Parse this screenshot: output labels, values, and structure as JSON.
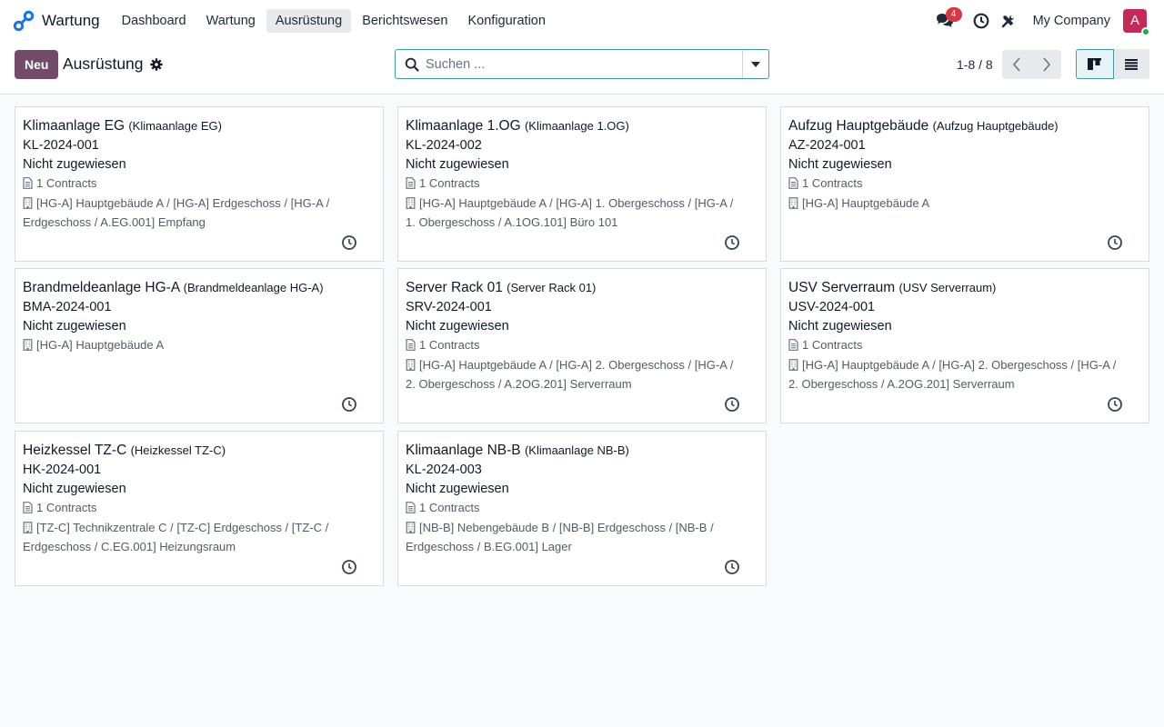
{
  "nav": {
    "app_name": "Wartung",
    "menu": [
      {
        "label": "Dashboard",
        "active": false
      },
      {
        "label": "Wartung",
        "active": false
      },
      {
        "label": "Ausrüstung",
        "active": true
      },
      {
        "label": "Berichtswesen",
        "active": false
      },
      {
        "label": "Konfiguration",
        "active": false
      }
    ],
    "messages_count": "4",
    "company": "My Company",
    "avatar_letter": "A"
  },
  "control": {
    "new_label": "Neu",
    "title": "Ausrüstung",
    "search_placeholder": "Suchen ...",
    "pager": "1-8 / 8"
  },
  "colors": {
    "brand": "#714b67",
    "accent": "#3f9d9d",
    "avatar": "#c42a55",
    "badge": "#dc3545"
  },
  "equipment": [
    {
      "name": "Klimaanlage EG",
      "display": "(Klimaanlage EG)",
      "code": "KL-2024-001",
      "assignee": "Nicht zugewiesen",
      "contracts": "1 Contracts",
      "location": "[HG-A] Hauptgebäude A / [HG-A] Erdgeschoss / [HG-A / Erdgeschoss / A.EG.001] Empfang",
      "loc1": "[HG-A] Hauptgebäude A / [HG-A] Erdgeschoss / [HG-A /",
      "loc2": "Erdgeschoss / A.EG.001] Empfang"
    },
    {
      "name": "Klimaanlage 1.OG",
      "display": "(Klimaanlage 1.OG)",
      "code": "KL-2024-002",
      "assignee": "Nicht zugewiesen",
      "contracts": "1 Contracts",
      "loc1": "[HG-A] Hauptgebäude A / [HG-A] 1. Obergeschoss / [HG-A /",
      "loc2": "1. Obergeschoss / A.1OG.101] Büro 101"
    },
    {
      "name": "Aufzug Hauptgebäude",
      "display": "(Aufzug Hauptgebäude)",
      "code": "AZ-2024-001",
      "assignee": "Nicht zugewiesen",
      "contracts": "1 Contracts",
      "loc1": "[HG-A] Hauptgebäude A",
      "loc2": ""
    },
    {
      "name": "Brandmeldeanlage HG-A",
      "display": "(Brandmeldeanlage HG-A)",
      "code": "BMA-2024-001",
      "assignee": "Nicht zugewiesen",
      "contracts": "",
      "loc1": "[HG-A] Hauptgebäude A",
      "loc2": ""
    },
    {
      "name": "Server Rack 01",
      "display": "(Server Rack 01)",
      "code": "SRV-2024-001",
      "assignee": "Nicht zugewiesen",
      "contracts": "1 Contracts",
      "loc1": "[HG-A] Hauptgebäude A / [HG-A] 2. Obergeschoss / [HG-A /",
      "loc2": "2. Obergeschoss / A.2OG.201] Serverraum"
    },
    {
      "name": "USV Serverraum",
      "display": "(USV Serverraum)",
      "code": "USV-2024-001",
      "assignee": "Nicht zugewiesen",
      "contracts": "1 Contracts",
      "loc1": "[HG-A] Hauptgebäude A / [HG-A] 2. Obergeschoss / [HG-A /",
      "loc2": "2. Obergeschoss / A.2OG.201] Serverraum"
    },
    {
      "name": "Heizkessel TZ-C",
      "display": "(Heizkessel TZ-C)",
      "code": "HK-2024-001",
      "assignee": "Nicht zugewiesen",
      "contracts": "1 Contracts",
      "loc1": "[TZ-C] Technikzentrale C / [TZ-C] Erdgeschoss / [TZ-C /",
      "loc2": "Erdgeschoss / C.EG.001] Heizungsraum"
    },
    {
      "name": "Klimaanlage NB-B",
      "display": "(Klimaanlage NB-B)",
      "code": "KL-2024-003",
      "assignee": "Nicht zugewiesen",
      "contracts": "1 Contracts",
      "loc1": "[NB-B] Nebengebäude B / [NB-B] Erdgeschoss / [NB-B /",
      "loc2": "Erdgeschoss / B.EG.001] Lager"
    }
  ]
}
